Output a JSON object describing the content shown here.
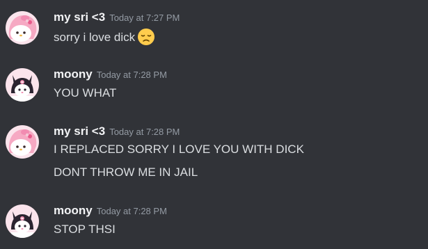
{
  "messages": [
    {
      "author": "my sri <3",
      "timestamp": "Today at 7:27 PM",
      "avatar_icon": "my-melody-avatar",
      "lines": [
        "sorry i love dick"
      ],
      "emoji": "disappointed-face-emoji"
    },
    {
      "author": "moony",
      "timestamp": "Today at 7:28 PM",
      "avatar_icon": "kuromi-avatar",
      "lines": [
        "YOU WHAT"
      ]
    },
    {
      "author": "my sri <3",
      "timestamp": "Today at 7:28 PM",
      "avatar_icon": "my-melody-avatar",
      "lines": [
        "I REPLACED SORRY I LOVE YOU WITH DICK",
        "DONT THROW ME IN JAIL"
      ]
    },
    {
      "author": "moony",
      "timestamp": "Today at 7:28 PM",
      "avatar_icon": "kuromi-avatar",
      "lines": [
        "STOP THSI"
      ]
    }
  ],
  "colors": {
    "background": "#313338",
    "username": "#f2f3f5",
    "timestamp": "#949ba4",
    "message_text": "#dbdee1"
  }
}
